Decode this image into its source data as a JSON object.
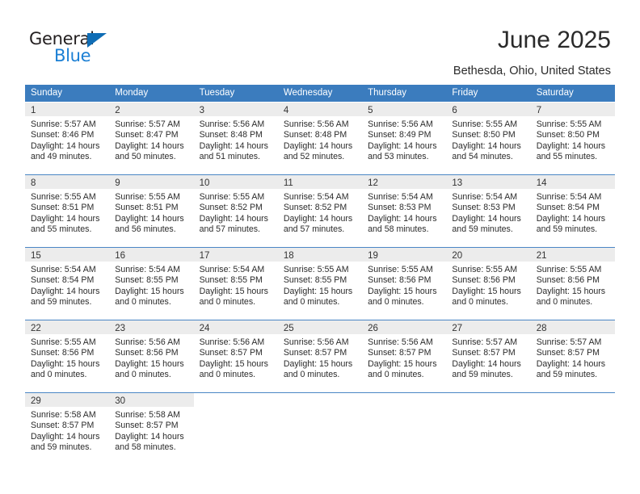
{
  "brand": {
    "name_top": "General",
    "name_bottom": "Blue",
    "accent_color": "#1b7fd4",
    "triangle_color": "#0f6db5"
  },
  "header": {
    "title": "June 2025",
    "location": "Bethesda, Ohio, United States"
  },
  "theme": {
    "header_row_bg": "#3b7cbe",
    "daynum_band_bg": "#ececec",
    "week_separator": "#4a86c5",
    "text_color": "#2b2b2b"
  },
  "weekdays": [
    "Sunday",
    "Monday",
    "Tuesday",
    "Wednesday",
    "Thursday",
    "Friday",
    "Saturday"
  ],
  "weeks": [
    [
      {
        "day": "1",
        "sunrise": "Sunrise: 5:57 AM",
        "sunset": "Sunset: 8:46 PM",
        "daylight_line1": "Daylight: 14 hours",
        "daylight_line2": "and 49 minutes."
      },
      {
        "day": "2",
        "sunrise": "Sunrise: 5:57 AM",
        "sunset": "Sunset: 8:47 PM",
        "daylight_line1": "Daylight: 14 hours",
        "daylight_line2": "and 50 minutes."
      },
      {
        "day": "3",
        "sunrise": "Sunrise: 5:56 AM",
        "sunset": "Sunset: 8:48 PM",
        "daylight_line1": "Daylight: 14 hours",
        "daylight_line2": "and 51 minutes."
      },
      {
        "day": "4",
        "sunrise": "Sunrise: 5:56 AM",
        "sunset": "Sunset: 8:48 PM",
        "daylight_line1": "Daylight: 14 hours",
        "daylight_line2": "and 52 minutes."
      },
      {
        "day": "5",
        "sunrise": "Sunrise: 5:56 AM",
        "sunset": "Sunset: 8:49 PM",
        "daylight_line1": "Daylight: 14 hours",
        "daylight_line2": "and 53 minutes."
      },
      {
        "day": "6",
        "sunrise": "Sunrise: 5:55 AM",
        "sunset": "Sunset: 8:50 PM",
        "daylight_line1": "Daylight: 14 hours",
        "daylight_line2": "and 54 minutes."
      },
      {
        "day": "7",
        "sunrise": "Sunrise: 5:55 AM",
        "sunset": "Sunset: 8:50 PM",
        "daylight_line1": "Daylight: 14 hours",
        "daylight_line2": "and 55 minutes."
      }
    ],
    [
      {
        "day": "8",
        "sunrise": "Sunrise: 5:55 AM",
        "sunset": "Sunset: 8:51 PM",
        "daylight_line1": "Daylight: 14 hours",
        "daylight_line2": "and 55 minutes."
      },
      {
        "day": "9",
        "sunrise": "Sunrise: 5:55 AM",
        "sunset": "Sunset: 8:51 PM",
        "daylight_line1": "Daylight: 14 hours",
        "daylight_line2": "and 56 minutes."
      },
      {
        "day": "10",
        "sunrise": "Sunrise: 5:55 AM",
        "sunset": "Sunset: 8:52 PM",
        "daylight_line1": "Daylight: 14 hours",
        "daylight_line2": "and 57 minutes."
      },
      {
        "day": "11",
        "sunrise": "Sunrise: 5:54 AM",
        "sunset": "Sunset: 8:52 PM",
        "daylight_line1": "Daylight: 14 hours",
        "daylight_line2": "and 57 minutes."
      },
      {
        "day": "12",
        "sunrise": "Sunrise: 5:54 AM",
        "sunset": "Sunset: 8:53 PM",
        "daylight_line1": "Daylight: 14 hours",
        "daylight_line2": "and 58 minutes."
      },
      {
        "day": "13",
        "sunrise": "Sunrise: 5:54 AM",
        "sunset": "Sunset: 8:53 PM",
        "daylight_line1": "Daylight: 14 hours",
        "daylight_line2": "and 59 minutes."
      },
      {
        "day": "14",
        "sunrise": "Sunrise: 5:54 AM",
        "sunset": "Sunset: 8:54 PM",
        "daylight_line1": "Daylight: 14 hours",
        "daylight_line2": "and 59 minutes."
      }
    ],
    [
      {
        "day": "15",
        "sunrise": "Sunrise: 5:54 AM",
        "sunset": "Sunset: 8:54 PM",
        "daylight_line1": "Daylight: 14 hours",
        "daylight_line2": "and 59 minutes."
      },
      {
        "day": "16",
        "sunrise": "Sunrise: 5:54 AM",
        "sunset": "Sunset: 8:55 PM",
        "daylight_line1": "Daylight: 15 hours",
        "daylight_line2": "and 0 minutes."
      },
      {
        "day": "17",
        "sunrise": "Sunrise: 5:54 AM",
        "sunset": "Sunset: 8:55 PM",
        "daylight_line1": "Daylight: 15 hours",
        "daylight_line2": "and 0 minutes."
      },
      {
        "day": "18",
        "sunrise": "Sunrise: 5:55 AM",
        "sunset": "Sunset: 8:55 PM",
        "daylight_line1": "Daylight: 15 hours",
        "daylight_line2": "and 0 minutes."
      },
      {
        "day": "19",
        "sunrise": "Sunrise: 5:55 AM",
        "sunset": "Sunset: 8:56 PM",
        "daylight_line1": "Daylight: 15 hours",
        "daylight_line2": "and 0 minutes."
      },
      {
        "day": "20",
        "sunrise": "Sunrise: 5:55 AM",
        "sunset": "Sunset: 8:56 PM",
        "daylight_line1": "Daylight: 15 hours",
        "daylight_line2": "and 0 minutes."
      },
      {
        "day": "21",
        "sunrise": "Sunrise: 5:55 AM",
        "sunset": "Sunset: 8:56 PM",
        "daylight_line1": "Daylight: 15 hours",
        "daylight_line2": "and 0 minutes."
      }
    ],
    [
      {
        "day": "22",
        "sunrise": "Sunrise: 5:55 AM",
        "sunset": "Sunset: 8:56 PM",
        "daylight_line1": "Daylight: 15 hours",
        "daylight_line2": "and 0 minutes."
      },
      {
        "day": "23",
        "sunrise": "Sunrise: 5:56 AM",
        "sunset": "Sunset: 8:56 PM",
        "daylight_line1": "Daylight: 15 hours",
        "daylight_line2": "and 0 minutes."
      },
      {
        "day": "24",
        "sunrise": "Sunrise: 5:56 AM",
        "sunset": "Sunset: 8:57 PM",
        "daylight_line1": "Daylight: 15 hours",
        "daylight_line2": "and 0 minutes."
      },
      {
        "day": "25",
        "sunrise": "Sunrise: 5:56 AM",
        "sunset": "Sunset: 8:57 PM",
        "daylight_line1": "Daylight: 15 hours",
        "daylight_line2": "and 0 minutes."
      },
      {
        "day": "26",
        "sunrise": "Sunrise: 5:56 AM",
        "sunset": "Sunset: 8:57 PM",
        "daylight_line1": "Daylight: 15 hours",
        "daylight_line2": "and 0 minutes."
      },
      {
        "day": "27",
        "sunrise": "Sunrise: 5:57 AM",
        "sunset": "Sunset: 8:57 PM",
        "daylight_line1": "Daylight: 14 hours",
        "daylight_line2": "and 59 minutes."
      },
      {
        "day": "28",
        "sunrise": "Sunrise: 5:57 AM",
        "sunset": "Sunset: 8:57 PM",
        "daylight_line1": "Daylight: 14 hours",
        "daylight_line2": "and 59 minutes."
      }
    ],
    [
      {
        "day": "29",
        "sunrise": "Sunrise: 5:58 AM",
        "sunset": "Sunset: 8:57 PM",
        "daylight_line1": "Daylight: 14 hours",
        "daylight_line2": "and 59 minutes."
      },
      {
        "day": "30",
        "sunrise": "Sunrise: 5:58 AM",
        "sunset": "Sunset: 8:57 PM",
        "daylight_line1": "Daylight: 14 hours",
        "daylight_line2": "and 58 minutes."
      },
      {
        "day": "",
        "sunrise": "",
        "sunset": "",
        "daylight_line1": "",
        "daylight_line2": ""
      },
      {
        "day": "",
        "sunrise": "",
        "sunset": "",
        "daylight_line1": "",
        "daylight_line2": ""
      },
      {
        "day": "",
        "sunrise": "",
        "sunset": "",
        "daylight_line1": "",
        "daylight_line2": ""
      },
      {
        "day": "",
        "sunrise": "",
        "sunset": "",
        "daylight_line1": "",
        "daylight_line2": ""
      },
      {
        "day": "",
        "sunrise": "",
        "sunset": "",
        "daylight_line1": "",
        "daylight_line2": ""
      }
    ]
  ]
}
